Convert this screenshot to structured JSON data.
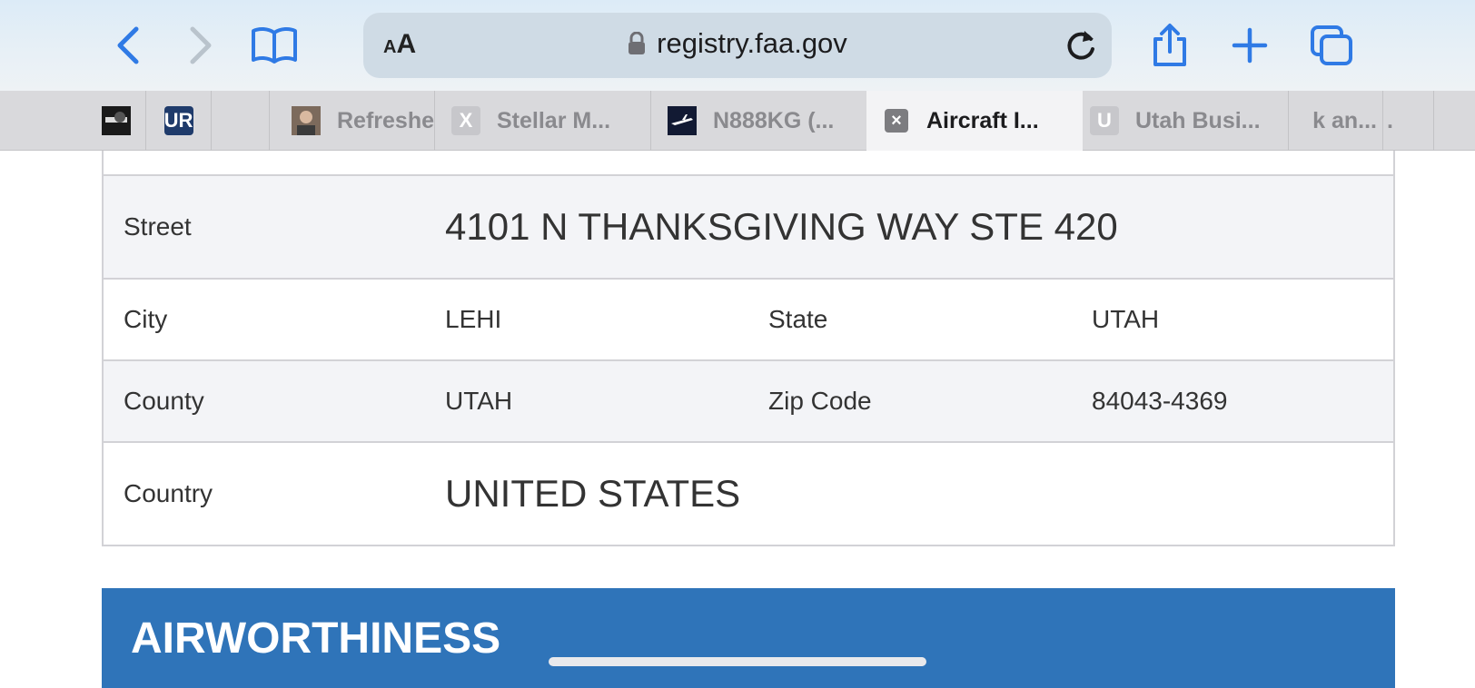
{
  "browser": {
    "url": "registry.faa.gov",
    "reader_label_small": "A",
    "reader_label_big": "A",
    "accent": "#2f7ae5"
  },
  "tabs": [
    {
      "label": "",
      "favicon": "dark-photo"
    },
    {
      "label": "",
      "favicon_text": "UR",
      "favicon": "ur-logo"
    },
    {
      "label": "",
      "favicon": "blank"
    },
    {
      "label": "Refreshe",
      "favicon": "person-photo"
    },
    {
      "label": "Stellar M...",
      "favicon_text": "X",
      "favicon": "x-letter"
    },
    {
      "label": "N888KG (...",
      "favicon": "airplane-photo"
    },
    {
      "label": "Aircraft I...",
      "favicon_text": "×",
      "favicon": "close-box",
      "active": true
    },
    {
      "label": "Utah Busi...",
      "favicon_text": "U",
      "favicon": "u-letter"
    },
    {
      "label": "k an...",
      "favicon": "none"
    },
    {
      "label": ".",
      "favicon": "none"
    }
  ],
  "registrant": {
    "street_label": "Street",
    "street_value": "4101 N THANKSGIVING WAY STE 420",
    "city_label": "City",
    "city_value": "LEHI",
    "state_label": "State",
    "state_value": "UTAH",
    "county_label": "County",
    "county_value": "UTAH",
    "zip_label": "Zip Code",
    "zip_value": "84043-4369",
    "country_label": "Country",
    "country_value": "UNITED STATES"
  },
  "section": {
    "title": "AIRWORTHINESS",
    "color": "#2f74b9"
  }
}
